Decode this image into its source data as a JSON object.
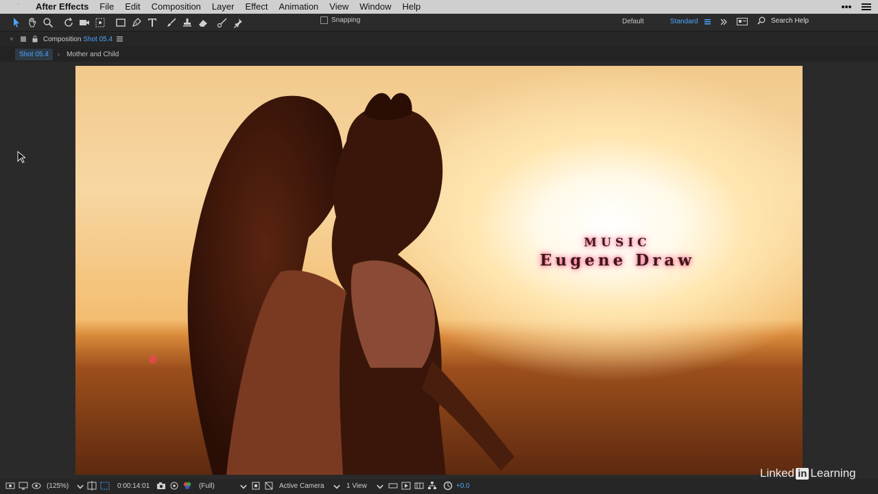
{
  "menubar": {
    "app_name": "After Effects",
    "items": [
      "File",
      "Edit",
      "Composition",
      "Layer",
      "Effect",
      "Animation",
      "View",
      "Window",
      "Help"
    ]
  },
  "toolbar": {
    "snapping_label": "Snapping",
    "workspace_default": "Default",
    "workspace_standard": "Standard",
    "search_placeholder": "Search Help"
  },
  "panel": {
    "title_prefix": "Composition",
    "title_comp": "Shot 05.4"
  },
  "breadcrumb": {
    "active": "Shot 05.4",
    "next": "Mother and Child"
  },
  "viewer": {
    "title_line1": "MUSIC",
    "title_line2": "Eugene Draw"
  },
  "statusbar": {
    "zoom": "(125%)",
    "timecode": "0:00:14:01",
    "resolution": "(Full)",
    "camera": "Active Camera",
    "views": "1 View",
    "exposure": "+0.0"
  },
  "brand": {
    "left": "Linked",
    "mid": "in",
    "right": " Learning"
  },
  "colors": {
    "accent": "#4da6ff",
    "panel_bg": "#2a2a2a",
    "menubar_bg": "#cfcfcf"
  }
}
